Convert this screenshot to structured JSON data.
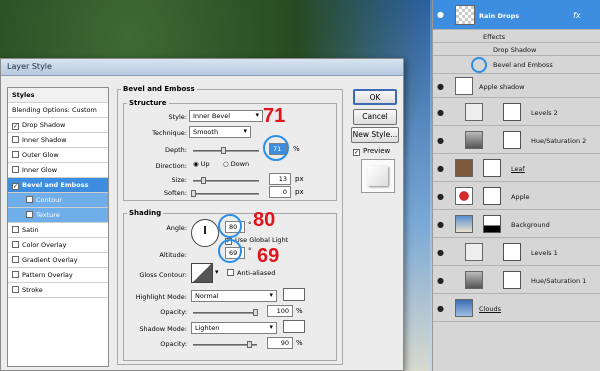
{
  "dialog": {
    "title": "Layer Style",
    "styles_header": "Styles",
    "style_items": [
      {
        "label": "Blending Options: Custom",
        "checked": null
      },
      {
        "label": "Drop Shadow",
        "checked": true
      },
      {
        "label": "Inner Shadow",
        "checked": false
      },
      {
        "label": "Outer Glow",
        "checked": false
      },
      {
        "label": "Inner Glow",
        "checked": false
      },
      {
        "label": "Bevel and Emboss",
        "checked": true
      },
      {
        "label": "Contour",
        "checked": false
      },
      {
        "label": "Texture",
        "checked": false
      },
      {
        "label": "Satin",
        "checked": false
      },
      {
        "label": "Color Overlay",
        "checked": false
      },
      {
        "label": "Gradient Overlay",
        "checked": false
      },
      {
        "label": "Pattern Overlay",
        "checked": false
      },
      {
        "label": "Stroke",
        "checked": false
      }
    ],
    "bevel_title": "Bevel and Emboss",
    "structure": {
      "title": "Structure",
      "style_label": "Style:",
      "style_value": "Inner Bevel",
      "technique_label": "Technique:",
      "technique_value": "Smooth",
      "depth_label": "Depth:",
      "depth_value": "71",
      "depth_unit": "%",
      "direction_label": "Direction:",
      "dir_up": "Up",
      "dir_down": "Down",
      "size_label": "Size:",
      "size_value": "13",
      "size_unit": "px",
      "soften_label": "Soften:",
      "soften_value": "0",
      "soften_unit": "px"
    },
    "shading": {
      "title": "Shading",
      "angle_label": "Angle:",
      "angle_value": "80",
      "angle_unit": "°",
      "global_light": "Use Global Light",
      "altitude_label": "Altitude:",
      "altitude_value": "69",
      "altitude_unit": "°",
      "gloss_label": "Gloss Contour:",
      "antialiased": "Anti-aliased",
      "highlight_label": "Highlight Mode:",
      "highlight_value": "Normal",
      "hl_opacity_label": "Opacity:",
      "hl_opacity_value": "100",
      "pct": "%",
      "shadow_label": "Shadow Mode:",
      "shadow_value": "Lighten",
      "sh_opacity_label": "Opacity:",
      "sh_opacity_value": "90"
    },
    "buttons": {
      "ok": "OK",
      "cancel": "Cancel",
      "new_style": "New Style...",
      "preview": "Preview"
    },
    "annotations": {
      "depth": "71",
      "angle": "80",
      "altitude": "69"
    }
  },
  "layers": {
    "items": [
      {
        "name": "Rain Drops",
        "fx": "fx"
      },
      {
        "name": "Effects"
      },
      {
        "name": "Drop Shadow"
      },
      {
        "name": "Bevel and Emboss"
      },
      {
        "name": "Apple shadow"
      },
      {
        "name": "Levels 2"
      },
      {
        "name": "Hue/Saturation 2"
      },
      {
        "name": "Leaf"
      },
      {
        "name": "Apple"
      },
      {
        "name": "Background"
      },
      {
        "name": "Levels 1"
      },
      {
        "name": "Hue/Saturation 1"
      },
      {
        "name": "Clouds"
      }
    ]
  }
}
